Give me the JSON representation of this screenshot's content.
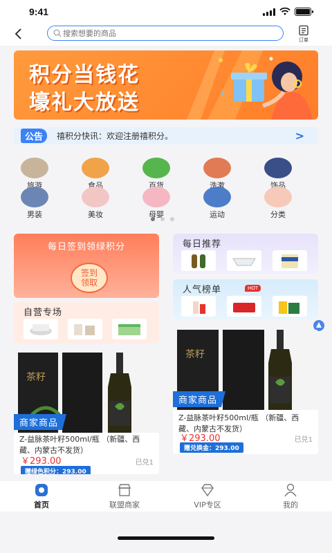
{
  "status_bar": {
    "time": "9:41"
  },
  "header": {
    "search_placeholder": "搜索想要的商品",
    "order_label": "订单"
  },
  "banner": {
    "line1": "积分当钱花",
    "line2": "壕礼大放送"
  },
  "notice": {
    "tag": "公告",
    "text": "禧积分快讯：欢迎注册禧积分。"
  },
  "categories": [
    {
      "label": "旅游",
      "color": "#c8b49a"
    },
    {
      "label": "食品",
      "color": "#f0a348"
    },
    {
      "label": "百货",
      "color": "#56b64d"
    },
    {
      "label": "洗漱",
      "color": "#e07b55"
    },
    {
      "label": "饰品",
      "color": "#3a4e88"
    },
    {
      "label": "男装",
      "color": "#6b86b5"
    },
    {
      "label": "美妆",
      "color": "#f3c6c6"
    },
    {
      "label": "母婴",
      "color": "#f5b7c4"
    },
    {
      "label": "运动",
      "color": "#4d7cc9"
    },
    {
      "label": "分类",
      "color": "#f7c9b8"
    }
  ],
  "checkin": {
    "title": "每日签到领绿积分",
    "button_line1": "签到",
    "button_line2": "领取"
  },
  "self_operated": {
    "title": "自营专场"
  },
  "daily_recommend": {
    "title": "每日推荐"
  },
  "popular": {
    "title": "人气榜单",
    "badge": "HOT"
  },
  "products": [
    {
      "tag": "商家商品",
      "name": "Z-益脉茶叶籽500ml/瓶 （新疆、西藏、内蒙古不发货）",
      "price": "￥293.00",
      "sold": "已兑1",
      "points": "赠绿色积分：293.00"
    },
    {
      "tag": "商家商品",
      "name": "Z-益脉茶叶籽500ml/瓶 （新疆、西藏、内蒙古不发货）",
      "price": "￥293.00",
      "sold": "已兑1",
      "points": "赠兑换金：293.00"
    }
  ],
  "tabbar": [
    {
      "label": "首页",
      "active": true
    },
    {
      "label": "联盟商家",
      "active": false
    },
    {
      "label": "VIP专区",
      "active": false
    },
    {
      "label": "我的",
      "active": false
    }
  ]
}
